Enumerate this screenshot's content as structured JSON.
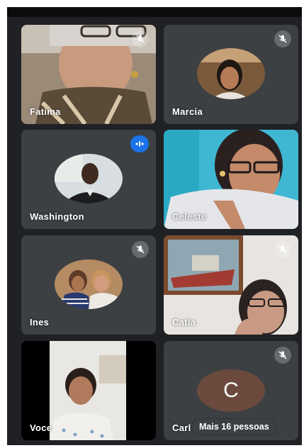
{
  "participants": [
    {
      "name": "Fatima",
      "muted": true,
      "view": "video"
    },
    {
      "name": "Marcia",
      "muted": true,
      "view": "avatar"
    },
    {
      "name": "Washington",
      "muted": false,
      "speaking": true,
      "view": "avatar"
    },
    {
      "name": "Celeste",
      "muted": false,
      "view": "video"
    },
    {
      "name": "Ines",
      "muted": true,
      "view": "avatar"
    },
    {
      "name": "Catia",
      "muted": true,
      "view": "video"
    },
    {
      "name": "Voce",
      "muted": false,
      "view": "video"
    },
    {
      "name": "Carl",
      "muted": true,
      "view": "letter",
      "initial": "C"
    }
  ],
  "more_label": "Mais 16 pessoas",
  "colors": {
    "tile_bg": "#3c4043",
    "speaking": "#1a73e8",
    "letter_avatar": "#6b4a3d",
    "background": "#202124"
  },
  "icons": {
    "muted": "mic-off-icon",
    "speaking": "audio-level-icon"
  }
}
